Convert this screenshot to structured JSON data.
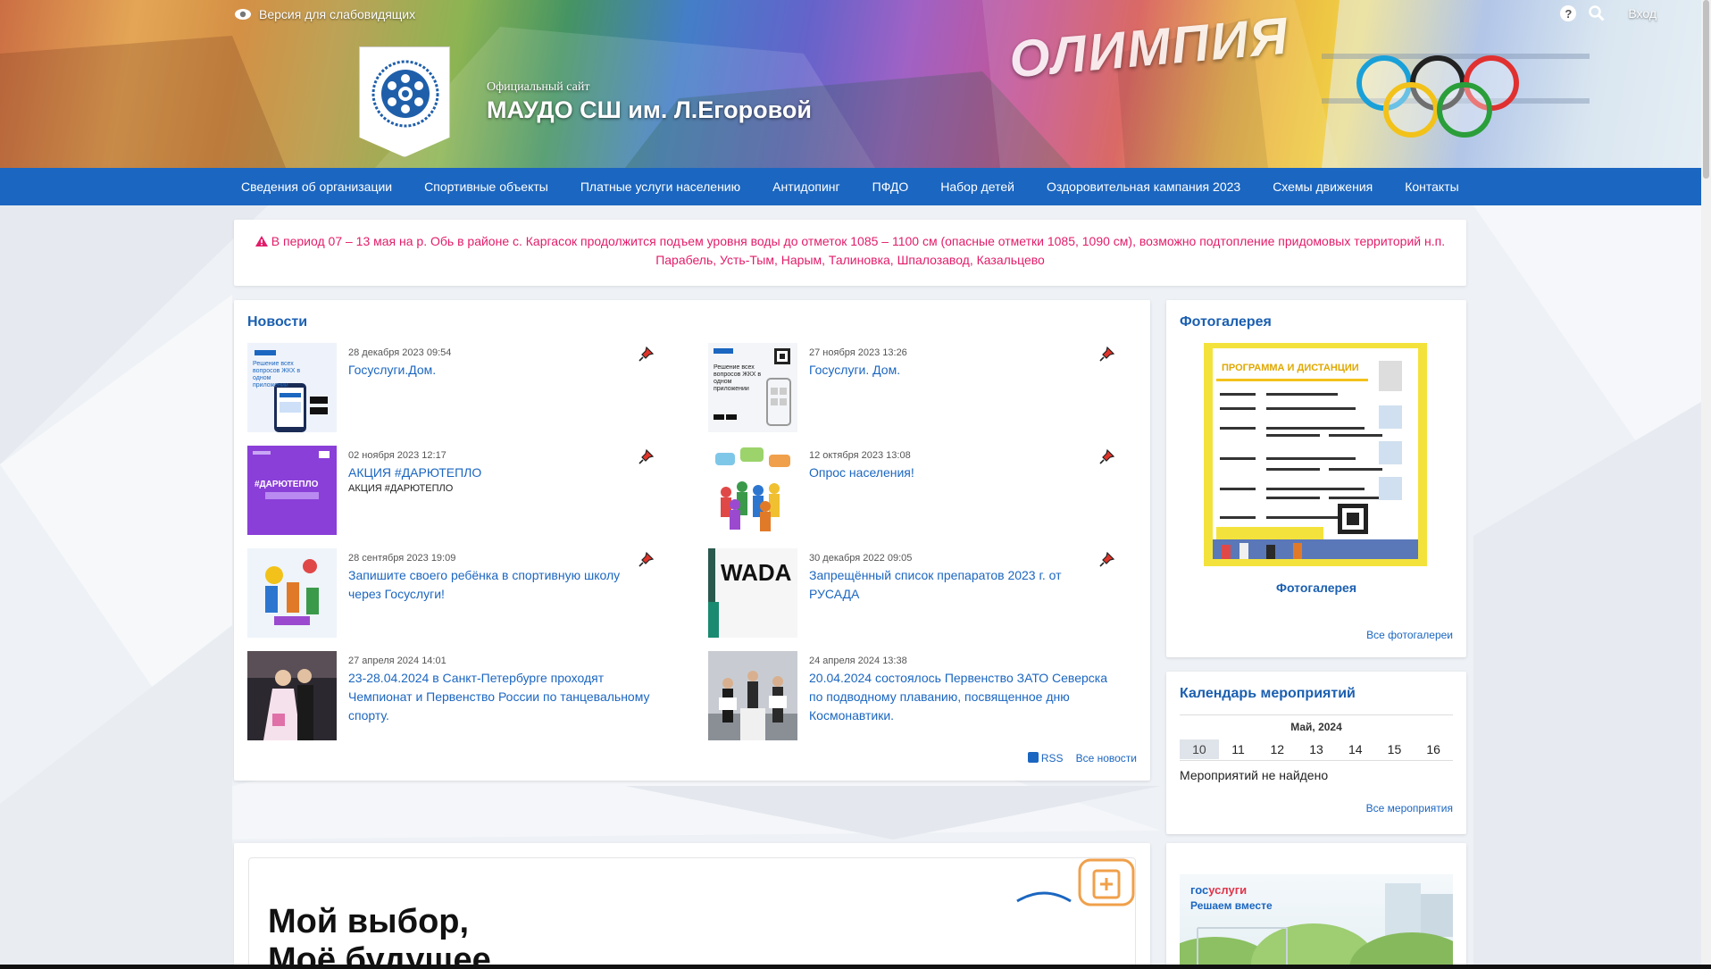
{
  "topbar": {
    "low_vision_label": "Версия для слабовидящих",
    "login_label": "Вход"
  },
  "header": {
    "subtitle": "Официальный сайт",
    "title": "МАУДО СШ им. Л.Егоровой",
    "building_sign": "ОЛИМПИЯ"
  },
  "nav": {
    "items": [
      {
        "label": "Сведения об организации"
      },
      {
        "label": "Спортивные объекты"
      },
      {
        "label": "Платные услуги населению"
      },
      {
        "label": "Антидопинг"
      },
      {
        "label": "ПФДО"
      },
      {
        "label": "Набор детей"
      },
      {
        "label": "Оздоровительная кампания 2023"
      },
      {
        "label": "Схемы движения"
      },
      {
        "label": "Контакты"
      }
    ]
  },
  "alert": {
    "text": "В период 07 – 13 мая на р. Обь в районе с. Каргасок продолжится подъем уровня воды до отметок 1085 – 1100 см (опасные отметки 1085, 1090 см), возможно подтопление придомовых территорий н.п. Парабель, Усть-Тым, Нарым, Талиновка, Шпалозавод, Казальцево"
  },
  "news": {
    "title": "Новости",
    "items": [
      {
        "date": "28 декабря 2023 09:54",
        "title": "Госуслуги.Дом.",
        "subtitle": ""
      },
      {
        "date": "27 ноября 2023 13:26",
        "title": "Госуслуги. Дом.",
        "subtitle": ""
      },
      {
        "date": "02 ноября 2023 12:17",
        "title": "АКЦИЯ #ДАРЮТЕПЛО",
        "subtitle": "АКЦИЯ #ДАРЮТЕПЛО"
      },
      {
        "date": "12 октября 2023 13:08",
        "title": "Опрос населения!",
        "subtitle": ""
      },
      {
        "date": "28 сентября 2023 19:09",
        "title": "Запишите своего ребёнка в спортивную школу через Госуслуги!",
        "subtitle": ""
      },
      {
        "date": "30 декабря 2022 09:05",
        "title": "Запрещённый список препаратов 2023 г. от РУСАДА",
        "subtitle": ""
      },
      {
        "date": "27 апреля 2024 14:01",
        "title": "23-28.04.2024 в Санкт-Петербурге проходят Чемпионат и Первенство России по танцевальному спорту.",
        "subtitle": ""
      },
      {
        "date": "24 апреля 2024 13:38",
        "title": "20.04.2024 состоялось Первенство ЗАТО Северска по подводному плаванию, посвященное дню Космонавтики.",
        "subtitle": ""
      }
    ],
    "thumbs": {
      "gosdom_1": "Решение всех вопросов ЖКХ в одном приложении",
      "gosdom_2": "Решение всех вопросов ЖКХ в одном приложении",
      "darju": "#ДАРЮТЕПЛО",
      "wada": "WADA"
    },
    "rss_label": "RSS",
    "all_label": "Все новости"
  },
  "gallery": {
    "title": "Фотогалерея",
    "poster_heading": "ПРОГРАММА И ДИСТАНЦИИ",
    "caption": "Фотогалерея",
    "all_label": "Все фотогалереи"
  },
  "calendar": {
    "title": "Календарь мероприятий",
    "month": "Май, 2024",
    "days": [
      "10",
      "11",
      "12",
      "13",
      "14",
      "15",
      "16"
    ],
    "active_day": "10",
    "empty_text": "Мероприятий не найдено",
    "all_label": "Все мероприятия"
  },
  "promo": {
    "line1": "Мой выбор,",
    "line2": "Моё будущее"
  },
  "gosuslugi": {
    "logo_part1": "гос",
    "logo_part2": "услуги",
    "tagline": "Решаем вместе"
  },
  "colors": {
    "accent": "#1b66c0",
    "alert": "#e21c69",
    "pin": "#e0342a"
  }
}
